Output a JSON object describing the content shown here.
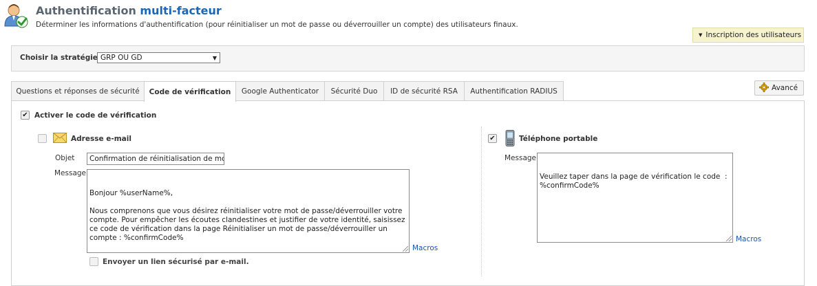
{
  "header": {
    "title_main": "Authentification",
    "title_accent": "multi-facteur",
    "subtitle": "Déterminer les informations d'authentification (pour réinitialiser un mot de passe ou déverrouiller un compte) des utilisateurs finaux."
  },
  "enroll_button": {
    "label": "Inscription des utilisateurs"
  },
  "strategy": {
    "label": "Choisir la stratégie",
    "selected": "GRP OU GD"
  },
  "tabs": [
    {
      "label": "Questions et réponses de sécurité",
      "active": false
    },
    {
      "label": "Code de vérification",
      "active": true
    },
    {
      "label": "Google Authenticator",
      "active": false
    },
    {
      "label": "Sécurité Duo",
      "active": false
    },
    {
      "label": "ID de sécurité RSA",
      "active": false
    },
    {
      "label": "Authentification RADIUS",
      "active": false
    }
  ],
  "advanced_button": {
    "label": "Avancé"
  },
  "verification": {
    "enable_label": "Activer le code de vérification",
    "enabled": true,
    "email": {
      "label": "Adresse e-mail",
      "checked": false,
      "subject_label": "Objet",
      "subject_value": "Confirmation de réinitialisation de mot",
      "message_label": "Message",
      "message_value": "Bonjour %userName%,\n\nNous comprenons que vous désirez réinitialiser votre mot de passe/déverrouiller votre compte. Pour empêcher les écoutes clandestines et justifier de votre identité, saisissez ce code de vérification dans la page Réinitialiser un mot de passe/déverrouiller un compte : %confirmCode%\n\nCordialement,\nAdministrateur",
      "macros_label": "Macros",
      "secure_link_label": "Envoyer un lien sécurisé par e-mail.",
      "secure_link_checked": false
    },
    "mobile": {
      "label": "Téléphone portable",
      "checked": true,
      "message_label": "Message",
      "message_value": "Veuillez taper dans la page de vérification le code  : %confirmCode%",
      "macros_label": "Macros"
    }
  },
  "colors": {
    "title_accent": "#1a66b8",
    "enroll_bg": "#f7f3cf",
    "link": "#1a56b0"
  },
  "icons": {
    "app": "user-check-icon",
    "gear": "gear-icon",
    "email": "envelope-icon",
    "mobile": "mobile-phone-icon"
  }
}
